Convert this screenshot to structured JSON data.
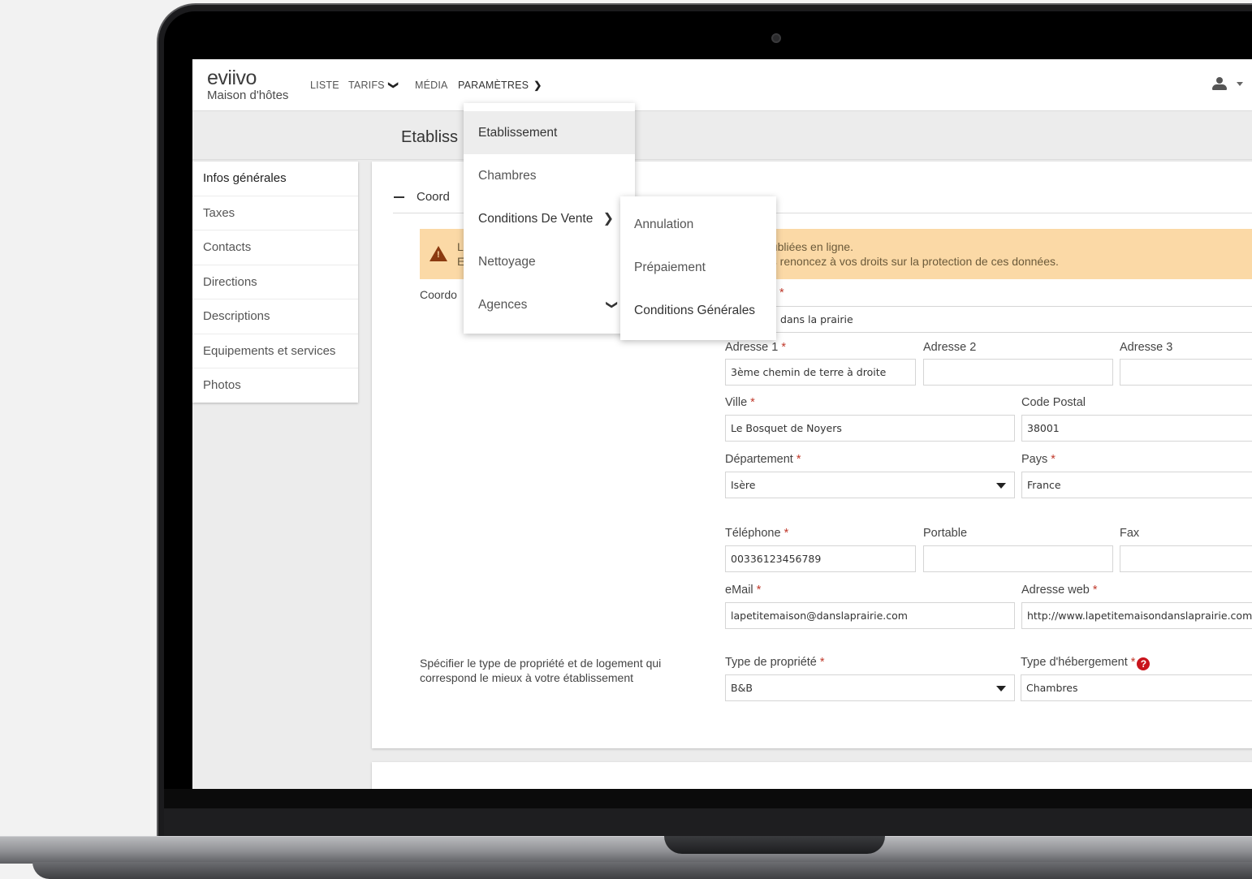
{
  "app": {
    "logo": "eviivo",
    "sublogo": "Maison d'hôtes",
    "nav": [
      {
        "label": "LISTE"
      },
      {
        "label": "TARIFS"
      },
      {
        "label": "MÉDIA"
      },
      {
        "label": "PARAMÈTRES"
      }
    ],
    "user_icon": "user-icon"
  },
  "page": {
    "title": "Etabliss"
  },
  "sidebar": {
    "items": [
      {
        "label": "Infos générales"
      },
      {
        "label": "Taxes"
      },
      {
        "label": "Contacts"
      },
      {
        "label": "Directions"
      },
      {
        "label": "Descriptions"
      },
      {
        "label": "Equipements et services"
      },
      {
        "label": "Photos"
      }
    ]
  },
  "section": {
    "title": "Coord"
  },
  "alert": {
    "line1_left": "L",
    "line1_right": "publiées en ligne.",
    "line2_left": "E",
    "line2_right": "us renoncez à vos droits sur la protection de ces données.",
    "color": "#fbd9a6"
  },
  "labels": {
    "coordonnees": "Coordo",
    "property_type_help_1": "Spécifier le type de propriété et de logement qui",
    "property_type_help_2": "correspond le mieux à votre établissement"
  },
  "form": {
    "name_label_tail": "*",
    "name_value": "e maison dans la prairie",
    "adresse1_label": "Adresse 1",
    "adresse1_value": "3ème chemin de terre à droite",
    "adresse2_label": "Adresse 2",
    "adresse2_value": "",
    "adresse3_label": "Adresse 3",
    "adresse3_value": "",
    "ville_label": "Ville",
    "ville_value": "Le Bosquet de Noyers",
    "cp_label": "Code Postal",
    "cp_value": "38001",
    "dept_label": "Département",
    "dept_value": "Isère",
    "pays_label": "Pays",
    "pays_value": "France",
    "tel_label": "Téléphone",
    "tel_value": "00336123456789",
    "portable_label": "Portable",
    "portable_value": "",
    "fax_label": "Fax",
    "fax_value": "",
    "email_label": "eMail",
    "email_value": "lapetitemaison@danslaprairie.com",
    "web_label": "Adresse web",
    "web_value": "http://www.lapetitemaisondanslaprairie.com",
    "prop_type_label": "Type de propriété",
    "prop_type_value": "B&B",
    "heberg_label": "Type d'hébergement",
    "heberg_value": "Chambres",
    "required_mark": "*"
  },
  "menu_parametres": {
    "items": [
      {
        "label": "Etablissement"
      },
      {
        "label": "Chambres"
      },
      {
        "label": "Conditions De Vente"
      },
      {
        "label": "Nettoyage"
      },
      {
        "label": "Agences"
      }
    ]
  },
  "menu_conditions": {
    "items": [
      {
        "label": "Annulation"
      },
      {
        "label": "Prépaiement"
      },
      {
        "label": "Conditions Générales"
      }
    ]
  }
}
